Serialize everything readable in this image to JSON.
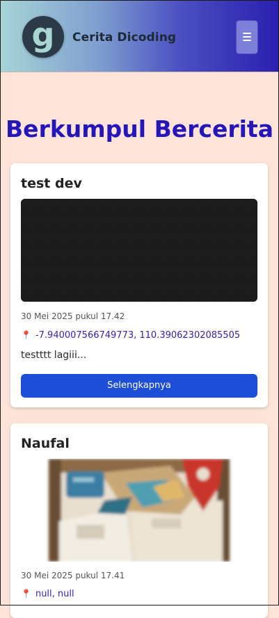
{
  "header": {
    "brand": "Cerita Dicoding",
    "logo_letter": "g",
    "menu_icon": "hamburger-menu-icon"
  },
  "main": {
    "title": "Berkumpul Bercerita"
  },
  "stories": [
    {
      "title": "test dev",
      "date": "30 Mei 2025 pukul 17.42",
      "location": "-7.940007566749773, 110.39062302085505",
      "description": "testttt lagiii...",
      "button": "Selengkapnya"
    },
    {
      "title": "Naufal",
      "date": "30 Mei 2025 pukul 17.41",
      "location": "null, null"
    }
  ],
  "colors": {
    "accent": "#2416b8",
    "button": "#1d4ed8",
    "background": "#fde3d8"
  }
}
